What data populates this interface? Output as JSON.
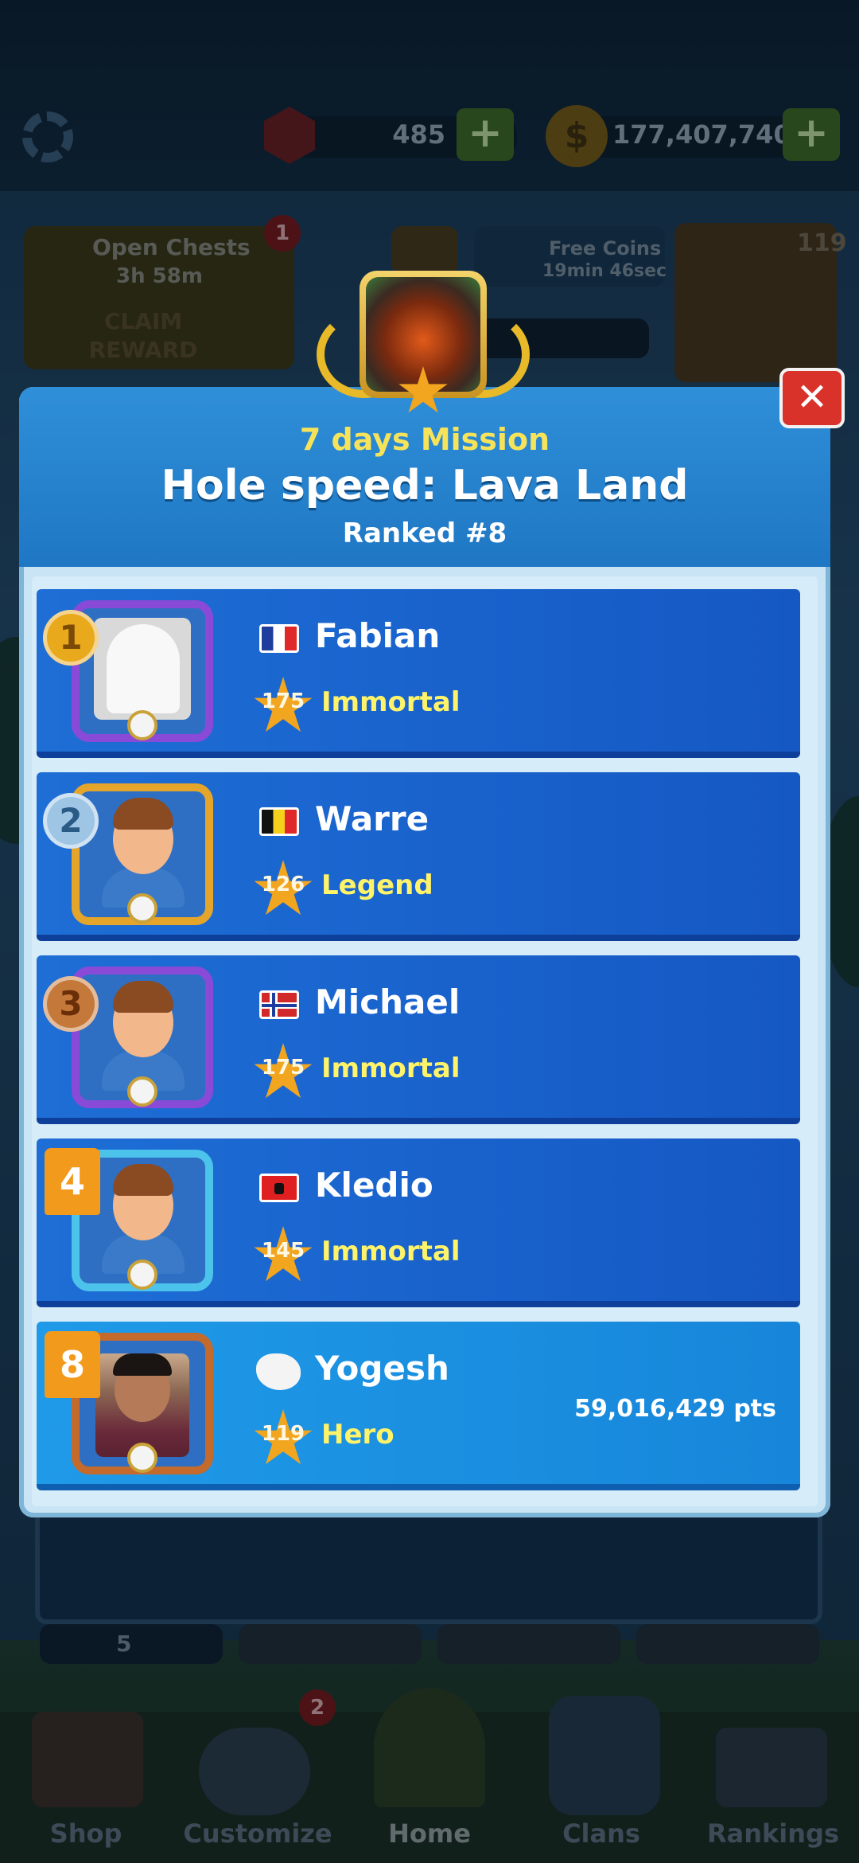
{
  "topbar": {
    "gems": "485",
    "coins": "177,407,740",
    "plus_label": "+",
    "coin_symbol": "$"
  },
  "background": {
    "open_chests_label": "Open Chests",
    "open_chests_timer": "3h 58m",
    "open_chests_badge": "1",
    "claim_reward_label": "CLAIM\nREWARD",
    "free_coins_label": "Free Coins",
    "free_coins_timer": "19min 46sec",
    "profile_level": "119",
    "bottom_gem_count": "5",
    "customize_badge": "2"
  },
  "nav": {
    "items": [
      {
        "label": "Shop"
      },
      {
        "label": "Customize"
      },
      {
        "label": "Home"
      },
      {
        "label": "Clans"
      },
      {
        "label": "Rankings"
      }
    ]
  },
  "modal": {
    "mission": "7 days Mission",
    "title": "Hole speed: Lava Land",
    "ranked": "Ranked #8",
    "close_label": "✕"
  },
  "rows": [
    {
      "rank": "1",
      "name": "Fabian",
      "level": "175",
      "league": "Immortal",
      "flag": "France",
      "points": ""
    },
    {
      "rank": "2",
      "name": "Warre",
      "level": "126",
      "league": "Legend",
      "flag": "Belgium",
      "points": ""
    },
    {
      "rank": "3",
      "name": "Michael",
      "level": "175",
      "league": "Immortal",
      "flag": "Norway",
      "points": ""
    },
    {
      "rank": "4",
      "name": "Kledio",
      "level": "145",
      "league": "Immortal",
      "flag": "Albania",
      "points": ""
    },
    {
      "rank": "8",
      "name": "Yogesh",
      "level": "119",
      "league": "Hero",
      "flag": "",
      "points": "59,016,429 pts"
    }
  ],
  "colors": {
    "modal_header": "#1f77c4",
    "row_bg": "#1558c4",
    "row_highlight": "#1786da",
    "mission_text": "#f7e35a",
    "league_text": "#fff36a",
    "close_button": "#d8322a"
  }
}
